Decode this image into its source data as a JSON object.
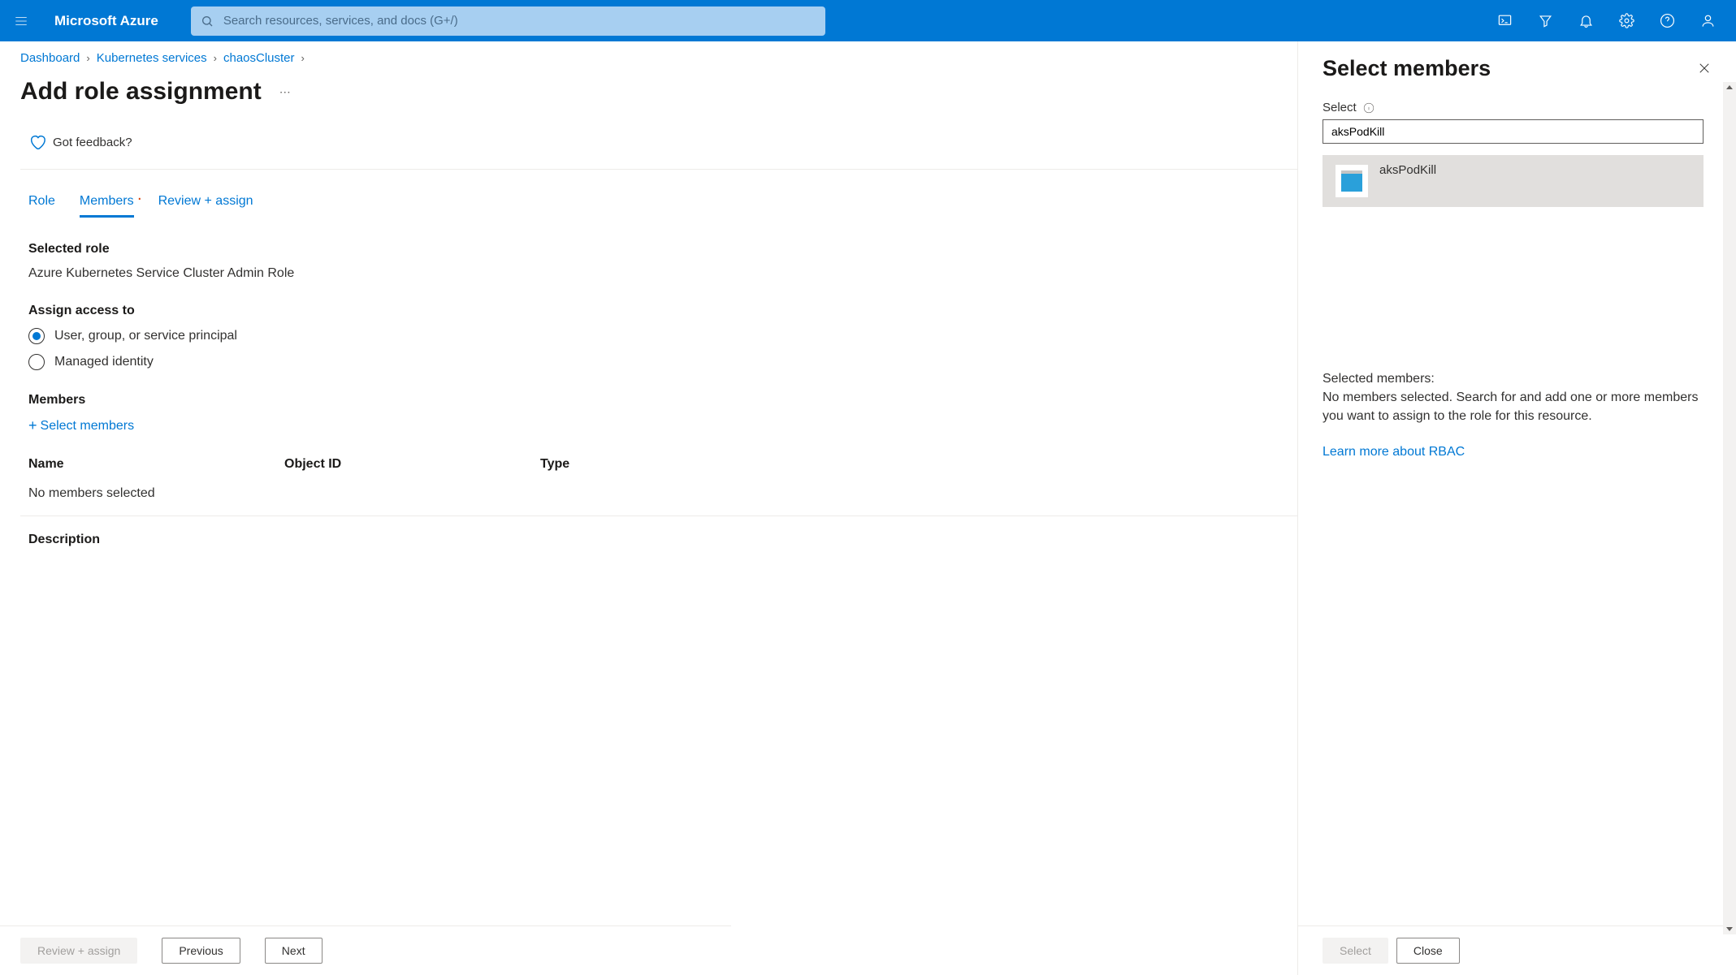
{
  "header": {
    "brand": "Microsoft Azure",
    "search_placeholder": "Search resources, services, and docs (G+/)"
  },
  "breadcrumb": {
    "items": [
      "Dashboard",
      "Kubernetes services",
      "chaosCluster"
    ]
  },
  "page": {
    "title": "Add role assignment",
    "feedback_label": "Got feedback?"
  },
  "tabs": {
    "role": "Role",
    "members": "Members",
    "review": "Review + assign"
  },
  "form": {
    "selected_role_label": "Selected role",
    "selected_role_value": "Azure Kubernetes Service Cluster Admin Role",
    "assign_access_label": "Assign access to",
    "radio_user": "User, group, or service principal",
    "radio_managed": "Managed identity",
    "members_label": "Members",
    "select_members_link": "Select members",
    "table": {
      "name": "Name",
      "object_id": "Object ID",
      "type": "Type",
      "empty": "No members selected"
    },
    "description_label": "Description"
  },
  "buttons": {
    "review_assign": "Review + assign",
    "previous": "Previous",
    "next": "Next"
  },
  "panel": {
    "title": "Select members",
    "select_label": "Select",
    "input_value": "aksPodKill",
    "result_name": "aksPodKill",
    "selected_label": "Selected members:",
    "empty_text": "No members selected. Search for and add one or more members you want to assign to the role for this resource.",
    "learn_link": "Learn more about RBAC",
    "select_btn": "Select",
    "close_btn": "Close"
  }
}
